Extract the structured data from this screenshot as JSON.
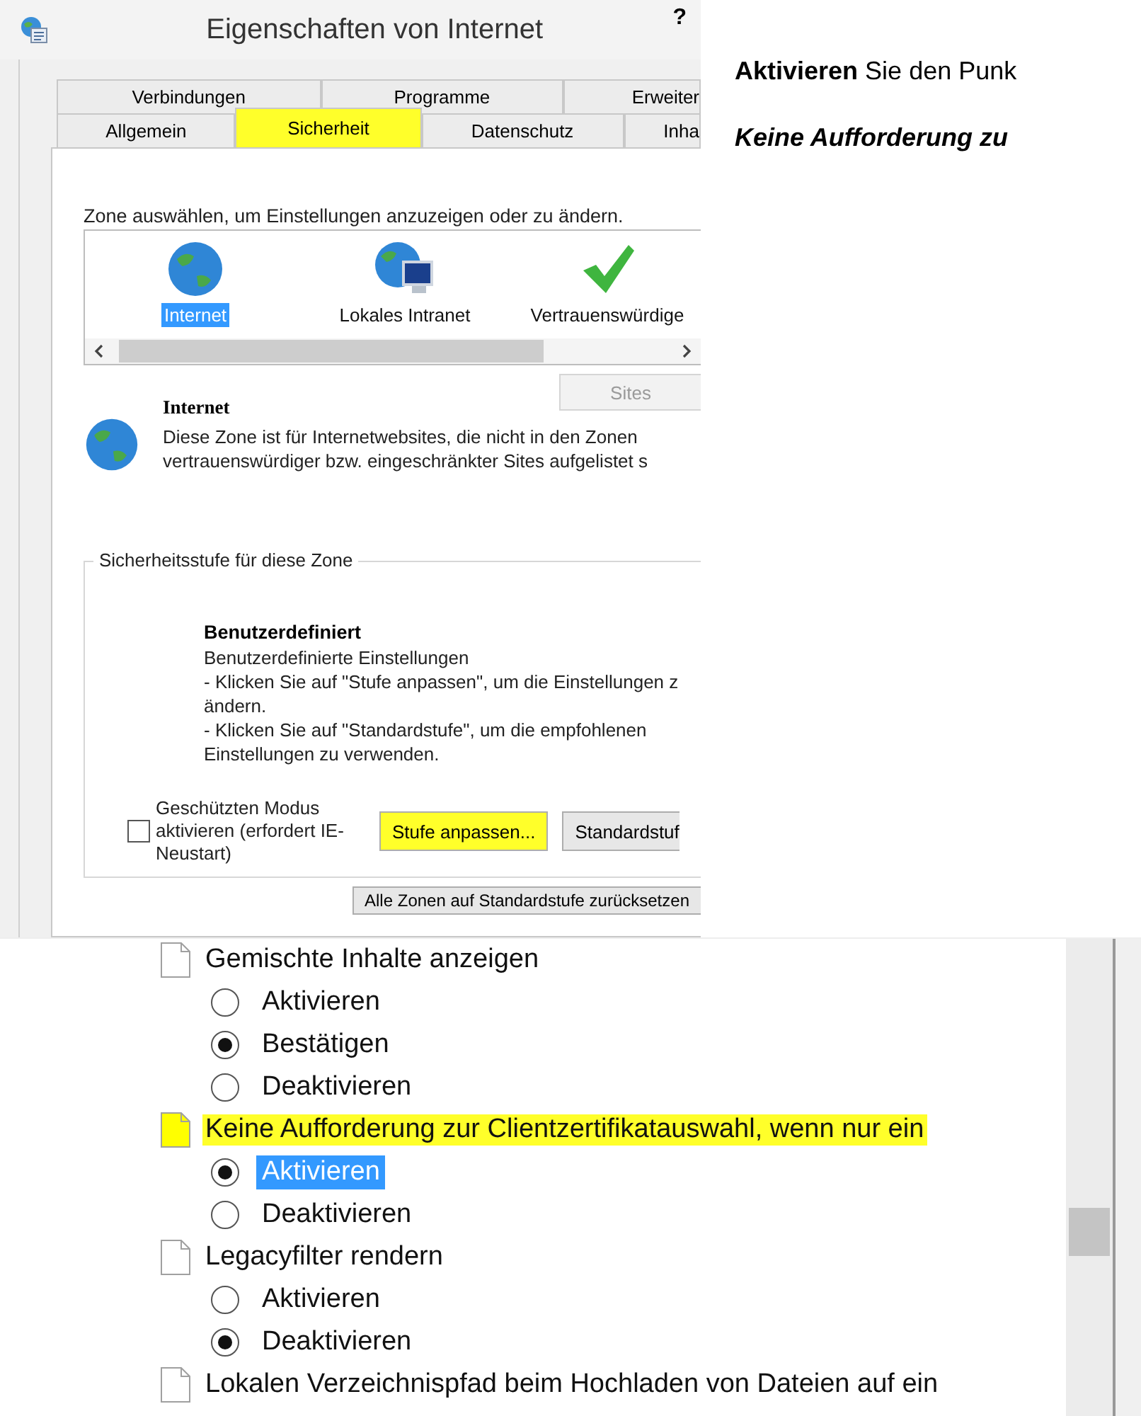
{
  "window": {
    "title": "Eigenschaften von Internet",
    "help": "?"
  },
  "tab_rows": [
    {
      "tabs": [
        {
          "label": "Verbindungen",
          "selected": false,
          "highlighted": false
        },
        {
          "label": "Programme",
          "selected": false,
          "highlighted": false
        },
        {
          "label": "Erweiter",
          "selected": false,
          "highlighted": false
        }
      ]
    },
    {
      "tabs": [
        {
          "label": "Allgemein",
          "selected": false,
          "highlighted": false
        },
        {
          "label": "Sicherheit",
          "selected": true,
          "highlighted": true
        },
        {
          "label": "Datenschutz",
          "selected": false,
          "highlighted": false
        },
        {
          "label": "Inha",
          "selected": false,
          "highlighted": false
        }
      ]
    }
  ],
  "zone_prompt": "Zone auswählen, um Einstellungen anzuzeigen oder zu ändern.",
  "zones": [
    {
      "label": "Internet",
      "kind": "internet",
      "selected": true
    },
    {
      "label": "Lokales Intranet",
      "kind": "intranet",
      "selected": false
    },
    {
      "label": "Vertrauenswürdige",
      "kind": "trusted",
      "selected": false
    }
  ],
  "sites_button": {
    "label": "Sites",
    "disabled": true
  },
  "zone_info": {
    "title": "Internet",
    "lines": [
      "Diese Zone ist für Internetwebsites, die nicht in den Zonen",
      "vertrauenswürdiger bzw. eingeschränkter Sites aufgelistet s"
    ]
  },
  "security_level": {
    "legend": "Sicherheitsstufe für diese Zone",
    "title": "Benutzerdefiniert",
    "lines": [
      "Benutzerdefinierte Einstellungen",
      "- Klicken Sie auf \"Stufe anpassen\", um die Einstellungen z",
      "ändern.",
      "- Klicken Sie auf \"Standardstufe\", um die empfohlenen",
      "Einstellungen zu verwenden."
    ]
  },
  "protected_mode": {
    "label": "Geschützten Modus aktivieren (erfordert IE-Neustart)",
    "checked": false
  },
  "level_buttons": [
    {
      "label": "Stufe anpassen...",
      "highlighted": true
    },
    {
      "label": "Standardstuf",
      "highlighted": false
    }
  ],
  "reset_button": {
    "label": "Alle Zonen auf Standardstufe zurücksetzen"
  },
  "notes": [
    {
      "text": "**Aktivieren** Sie den Punk",
      "kind": "mixed"
    },
    {
      "text": "Keine Aufforderung zu",
      "kind": "bold"
    }
  ],
  "settings": [
    {
      "label": "Gemischte Inhalte anzeigen",
      "highlighted": false,
      "options": [
        {
          "label": "Aktivieren",
          "selected": false,
          "focused": false
        },
        {
          "label": "Bestätigen",
          "selected": true,
          "focused": false
        },
        {
          "label": "Deaktivieren",
          "selected": false,
          "focused": false
        }
      ]
    },
    {
      "label": "Keine Aufforderung zur Clientzertifikatauswahl, wenn nur ein",
      "highlighted": true,
      "options": [
        {
          "label": "Aktivieren",
          "selected": true,
          "focused": true
        },
        {
          "label": "Deaktivieren",
          "selected": false,
          "focused": false
        }
      ]
    },
    {
      "label": "Legacyfilter rendern",
      "highlighted": false,
      "options": [
        {
          "label": "Aktivieren",
          "selected": false,
          "focused": false
        },
        {
          "label": "Deaktivieren",
          "selected": true,
          "focused": false
        }
      ]
    },
    {
      "label": "Lokalen Verzeichnispfad beim Hochladen von Dateien auf ein",
      "highlighted": false
    }
  ]
}
